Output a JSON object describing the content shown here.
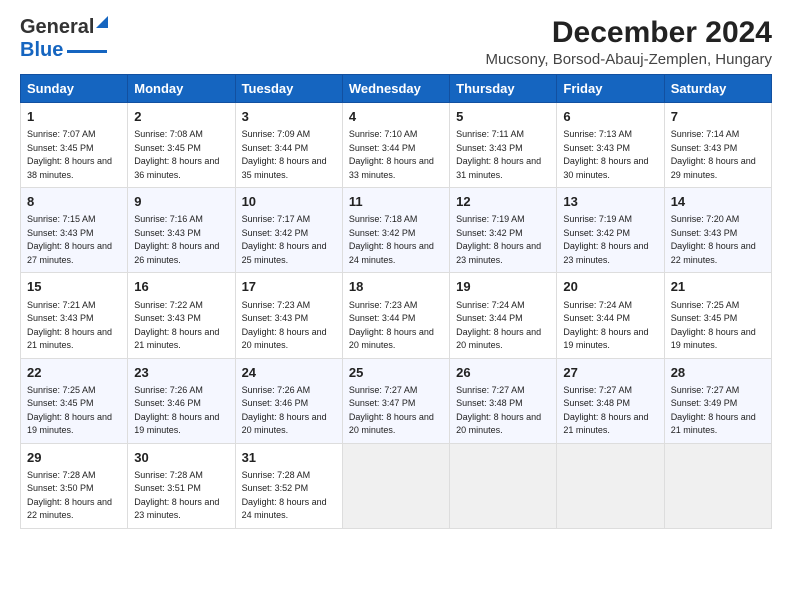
{
  "logo": {
    "line1": "General",
    "line2": "Blue"
  },
  "title": "December 2024",
  "subtitle": "Mucsony, Borsod-Abauj-Zemplen, Hungary",
  "days_of_week": [
    "Sunday",
    "Monday",
    "Tuesday",
    "Wednesday",
    "Thursday",
    "Friday",
    "Saturday"
  ],
  "weeks": [
    [
      {
        "day": 1,
        "sunrise": "7:07 AM",
        "sunset": "3:45 PM",
        "daylight": "8 hours and 38 minutes"
      },
      {
        "day": 2,
        "sunrise": "7:08 AM",
        "sunset": "3:45 PM",
        "daylight": "8 hours and 36 minutes"
      },
      {
        "day": 3,
        "sunrise": "7:09 AM",
        "sunset": "3:44 PM",
        "daylight": "8 hours and 35 minutes"
      },
      {
        "day": 4,
        "sunrise": "7:10 AM",
        "sunset": "3:44 PM",
        "daylight": "8 hours and 33 minutes"
      },
      {
        "day": 5,
        "sunrise": "7:11 AM",
        "sunset": "3:43 PM",
        "daylight": "8 hours and 31 minutes"
      },
      {
        "day": 6,
        "sunrise": "7:13 AM",
        "sunset": "3:43 PM",
        "daylight": "8 hours and 30 minutes"
      },
      {
        "day": 7,
        "sunrise": "7:14 AM",
        "sunset": "3:43 PM",
        "daylight": "8 hours and 29 minutes"
      }
    ],
    [
      {
        "day": 8,
        "sunrise": "7:15 AM",
        "sunset": "3:43 PM",
        "daylight": "8 hours and 27 minutes"
      },
      {
        "day": 9,
        "sunrise": "7:16 AM",
        "sunset": "3:43 PM",
        "daylight": "8 hours and 26 minutes"
      },
      {
        "day": 10,
        "sunrise": "7:17 AM",
        "sunset": "3:42 PM",
        "daylight": "8 hours and 25 minutes"
      },
      {
        "day": 11,
        "sunrise": "7:18 AM",
        "sunset": "3:42 PM",
        "daylight": "8 hours and 24 minutes"
      },
      {
        "day": 12,
        "sunrise": "7:19 AM",
        "sunset": "3:42 PM",
        "daylight": "8 hours and 23 minutes"
      },
      {
        "day": 13,
        "sunrise": "7:19 AM",
        "sunset": "3:42 PM",
        "daylight": "8 hours and 23 minutes"
      },
      {
        "day": 14,
        "sunrise": "7:20 AM",
        "sunset": "3:43 PM",
        "daylight": "8 hours and 22 minutes"
      }
    ],
    [
      {
        "day": 15,
        "sunrise": "7:21 AM",
        "sunset": "3:43 PM",
        "daylight": "8 hours and 21 minutes"
      },
      {
        "day": 16,
        "sunrise": "7:22 AM",
        "sunset": "3:43 PM",
        "daylight": "8 hours and 21 minutes"
      },
      {
        "day": 17,
        "sunrise": "7:23 AM",
        "sunset": "3:43 PM",
        "daylight": "8 hours and 20 minutes"
      },
      {
        "day": 18,
        "sunrise": "7:23 AM",
        "sunset": "3:44 PM",
        "daylight": "8 hours and 20 minutes"
      },
      {
        "day": 19,
        "sunrise": "7:24 AM",
        "sunset": "3:44 PM",
        "daylight": "8 hours and 20 minutes"
      },
      {
        "day": 20,
        "sunrise": "7:24 AM",
        "sunset": "3:44 PM",
        "daylight": "8 hours and 19 minutes"
      },
      {
        "day": 21,
        "sunrise": "7:25 AM",
        "sunset": "3:45 PM",
        "daylight": "8 hours and 19 minutes"
      }
    ],
    [
      {
        "day": 22,
        "sunrise": "7:25 AM",
        "sunset": "3:45 PM",
        "daylight": "8 hours and 19 minutes"
      },
      {
        "day": 23,
        "sunrise": "7:26 AM",
        "sunset": "3:46 PM",
        "daylight": "8 hours and 19 minutes"
      },
      {
        "day": 24,
        "sunrise": "7:26 AM",
        "sunset": "3:46 PM",
        "daylight": "8 hours and 20 minutes"
      },
      {
        "day": 25,
        "sunrise": "7:27 AM",
        "sunset": "3:47 PM",
        "daylight": "8 hours and 20 minutes"
      },
      {
        "day": 26,
        "sunrise": "7:27 AM",
        "sunset": "3:48 PM",
        "daylight": "8 hours and 20 minutes"
      },
      {
        "day": 27,
        "sunrise": "7:27 AM",
        "sunset": "3:48 PM",
        "daylight": "8 hours and 21 minutes"
      },
      {
        "day": 28,
        "sunrise": "7:27 AM",
        "sunset": "3:49 PM",
        "daylight": "8 hours and 21 minutes"
      }
    ],
    [
      {
        "day": 29,
        "sunrise": "7:28 AM",
        "sunset": "3:50 PM",
        "daylight": "8 hours and 22 minutes"
      },
      {
        "day": 30,
        "sunrise": "7:28 AM",
        "sunset": "3:51 PM",
        "daylight": "8 hours and 23 minutes"
      },
      {
        "day": 31,
        "sunrise": "7:28 AM",
        "sunset": "3:52 PM",
        "daylight": "8 hours and 24 minutes"
      },
      null,
      null,
      null,
      null
    ]
  ]
}
